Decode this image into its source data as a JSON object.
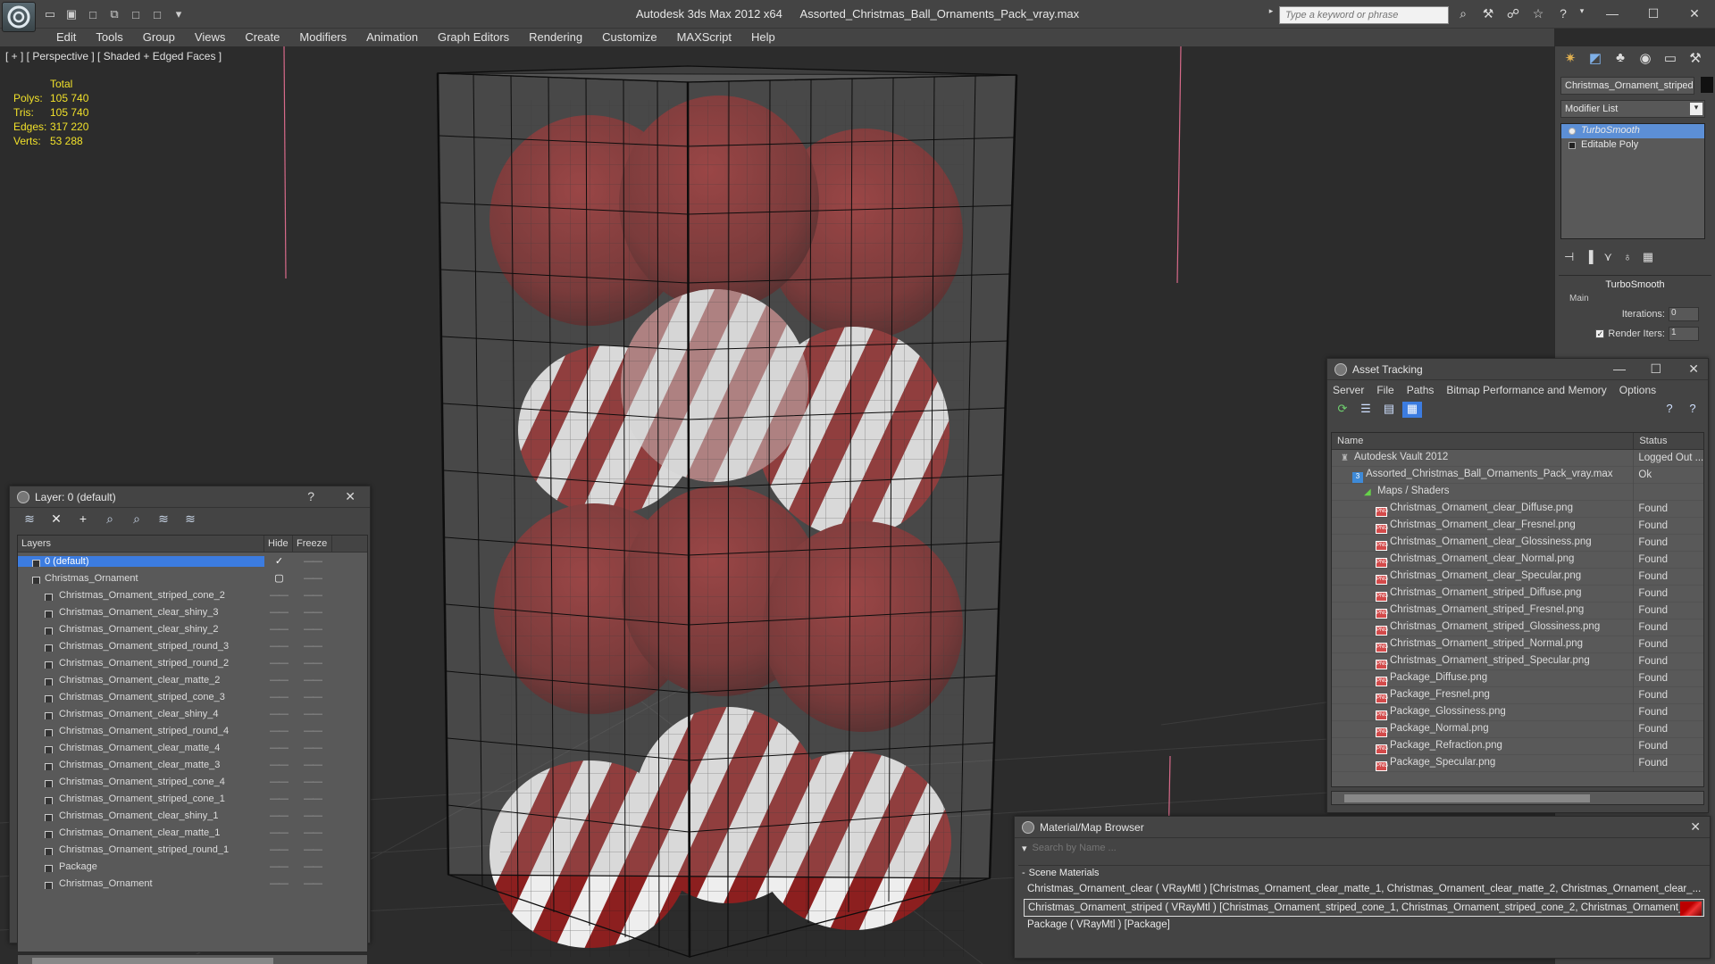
{
  "window": {
    "app_name": "Autodesk 3ds Max  2012 x64",
    "file_name": "Assorted_Christmas_Ball_Ornaments_Pack_vray.max",
    "search_placeholder": "Type a keyword or phrase"
  },
  "menu": [
    "Edit",
    "Tools",
    "Group",
    "Views",
    "Create",
    "Modifiers",
    "Animation",
    "Graph Editors",
    "Rendering",
    "Customize",
    "MAXScript",
    "Help"
  ],
  "viewport": {
    "label": "[ + ] [ Perspective ] [ Shaded + Edged Faces ]",
    "stats": {
      "header": "Total",
      "rows": [
        {
          "key": "Polys:",
          "value": "105 740"
        },
        {
          "key": "Tris:",
          "value": "105 740"
        },
        {
          "key": "Edges:",
          "value": "317 220"
        },
        {
          "key": "Verts:",
          "value": "53 288"
        }
      ]
    }
  },
  "command_panel": {
    "object_name": "Christmas_Ornament_striped",
    "modifier_list": "Modifier List",
    "stack": [
      "TurboSmooth",
      "Editable Poly"
    ],
    "rollout": {
      "title": "TurboSmooth",
      "group": "Main",
      "iterations_label": "Iterations:",
      "iterations_value": "0",
      "render_iters_label": "Render Iters:",
      "render_iters_value": "1"
    }
  },
  "layer_panel": {
    "title": "Layer: 0 (default)",
    "help": "?",
    "columns": {
      "layers": "Layers",
      "hide": "Hide",
      "freeze": "Freeze"
    },
    "rows": [
      {
        "name": "0 (default)",
        "level": 0,
        "selected": true
      },
      {
        "name": "Christmas_Ornament",
        "level": 0,
        "selected": false
      },
      {
        "name": "Christmas_Ornament_striped_cone_2",
        "level": 1
      },
      {
        "name": "Christmas_Ornament_clear_shiny_3",
        "level": 1
      },
      {
        "name": "Christmas_Ornament_clear_shiny_2",
        "level": 1
      },
      {
        "name": "Christmas_Ornament_striped_round_3",
        "level": 1
      },
      {
        "name": "Christmas_Ornament_striped_round_2",
        "level": 1
      },
      {
        "name": "Christmas_Ornament_clear_matte_2",
        "level": 1
      },
      {
        "name": "Christmas_Ornament_striped_cone_3",
        "level": 1
      },
      {
        "name": "Christmas_Ornament_clear_shiny_4",
        "level": 1
      },
      {
        "name": "Christmas_Ornament_striped_round_4",
        "level": 1
      },
      {
        "name": "Christmas_Ornament_clear_matte_4",
        "level": 1
      },
      {
        "name": "Christmas_Ornament_clear_matte_3",
        "level": 1
      },
      {
        "name": "Christmas_Ornament_striped_cone_4",
        "level": 1
      },
      {
        "name": "Christmas_Ornament_striped_cone_1",
        "level": 1
      },
      {
        "name": "Christmas_Ornament_clear_shiny_1",
        "level": 1
      },
      {
        "name": "Christmas_Ornament_clear_matte_1",
        "level": 1
      },
      {
        "name": "Christmas_Ornament_striped_round_1",
        "level": 1
      },
      {
        "name": "Package",
        "level": 1
      },
      {
        "name": "Christmas_Ornament",
        "level": 1
      }
    ]
  },
  "asset_tracking": {
    "title": "Asset Tracking",
    "menu": [
      "Server",
      "File",
      "Paths",
      "Bitmap Performance and Memory",
      "Options"
    ],
    "columns": {
      "name": "Name",
      "status": "Status"
    },
    "rows": [
      {
        "name": "Autodesk Vault 2012",
        "status": "Logged Out ...",
        "type": "vault",
        "indent": 1
      },
      {
        "name": "Assorted_Christmas_Ball_Ornaments_Pack_vray.max",
        "status": "Ok",
        "type": "max",
        "indent": 2
      },
      {
        "name": "Maps / Shaders",
        "status": "",
        "type": "maps",
        "indent": 3
      },
      {
        "name": "Christmas_Ornament_clear_Diffuse.png",
        "status": "Found",
        "type": "png",
        "indent": 4
      },
      {
        "name": "Christmas_Ornament_clear_Fresnel.png",
        "status": "Found",
        "type": "png",
        "indent": 4
      },
      {
        "name": "Christmas_Ornament_clear_Glossiness.png",
        "status": "Found",
        "type": "png",
        "indent": 4
      },
      {
        "name": "Christmas_Ornament_clear_Normal.png",
        "status": "Found",
        "type": "png",
        "indent": 4
      },
      {
        "name": "Christmas_Ornament_clear_Specular.png",
        "status": "Found",
        "type": "png",
        "indent": 4
      },
      {
        "name": "Christmas_Ornament_striped_Diffuse.png",
        "status": "Found",
        "type": "png",
        "indent": 4
      },
      {
        "name": "Christmas_Ornament_striped_Fresnel.png",
        "status": "Found",
        "type": "png",
        "indent": 4
      },
      {
        "name": "Christmas_Ornament_striped_Glossiness.png",
        "status": "Found",
        "type": "png",
        "indent": 4
      },
      {
        "name": "Christmas_Ornament_striped_Normal.png",
        "status": "Found",
        "type": "png",
        "indent": 4
      },
      {
        "name": "Christmas_Ornament_striped_Specular.png",
        "status": "Found",
        "type": "png",
        "indent": 4
      },
      {
        "name": "Package_Diffuse.png",
        "status": "Found",
        "type": "png",
        "indent": 4
      },
      {
        "name": "Package_Fresnel.png",
        "status": "Found",
        "type": "png",
        "indent": 4
      },
      {
        "name": "Package_Glossiness.png",
        "status": "Found",
        "type": "png",
        "indent": 4
      },
      {
        "name": "Package_Normal.png",
        "status": "Found",
        "type": "png",
        "indent": 4
      },
      {
        "name": "Package_Refraction.png",
        "status": "Found",
        "type": "png",
        "indent": 4
      },
      {
        "name": "Package_Specular.png",
        "status": "Found",
        "type": "png",
        "indent": 4
      }
    ]
  },
  "material_browser": {
    "title": "Material/Map Browser",
    "search_placeholder": "Search by Name ...",
    "section": "Scene Materials",
    "rows": [
      {
        "text": "Christmas_Ornament_clear  ( VRayMtl )  [Christmas_Ornament_clear_matte_1, Christmas_Ornament_clear_matte_2, Christmas_Ornament_clear_...",
        "selected": false
      },
      {
        "text": "Christmas_Ornament_striped ( VRayMtl ) [Christmas_Ornament_striped_cone_1, Christmas_Ornament_striped_cone_2, Christmas_Ornament_st...",
        "selected": true
      },
      {
        "text": "Package  ( VRayMtl )  [Package]",
        "selected": false
      }
    ]
  }
}
